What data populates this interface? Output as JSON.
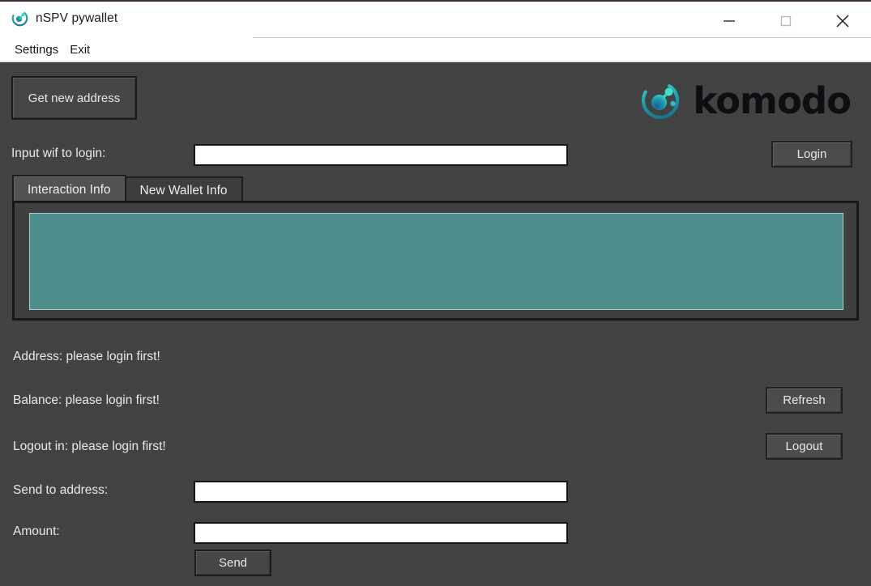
{
  "window": {
    "title": "nSPV pywallet",
    "app_icon": "komodo-circle-icon",
    "controls": {
      "minimize": "minimize-icon",
      "maximize": "maximize-icon",
      "close": "close-icon"
    }
  },
  "menubar": {
    "items": [
      {
        "label": "Settings"
      },
      {
        "label": "Exit"
      }
    ]
  },
  "toolbar": {
    "get_new_address_label": "Get new address"
  },
  "brand": {
    "mark": "komodo-logo-icon",
    "wordmark": "komodo"
  },
  "login": {
    "label": "Input wif to login:",
    "input_value": "",
    "input_placeholder": "",
    "button_label": "Login"
  },
  "tabs": [
    {
      "label": "Interaction Info",
      "active": true
    },
    {
      "label": "New Wallet Info",
      "active": false
    }
  ],
  "console": {
    "text": "",
    "background_color": "#4e8e8d"
  },
  "status": {
    "address": "Address: please login first!",
    "balance": "Balance: please login first!",
    "logout_in": "Logout in: please login first!"
  },
  "actions": {
    "refresh_label": "Refresh",
    "logout_label": "Logout",
    "send_label": "Send"
  },
  "send_form": {
    "address_label": "Send to address:",
    "address_value": "",
    "address_placeholder": "",
    "amount_label": "Amount:",
    "amount_value": "",
    "amount_placeholder": ""
  },
  "colors": {
    "window_background": "#424242",
    "titlebar_background": "#ffffff",
    "accent_teal": "#4e8e8d",
    "brand_cyan": "#27c5c0",
    "brand_blue": "#1f7f96",
    "text_light": "#e9e9e9",
    "text_dark": "#1d1d26"
  }
}
